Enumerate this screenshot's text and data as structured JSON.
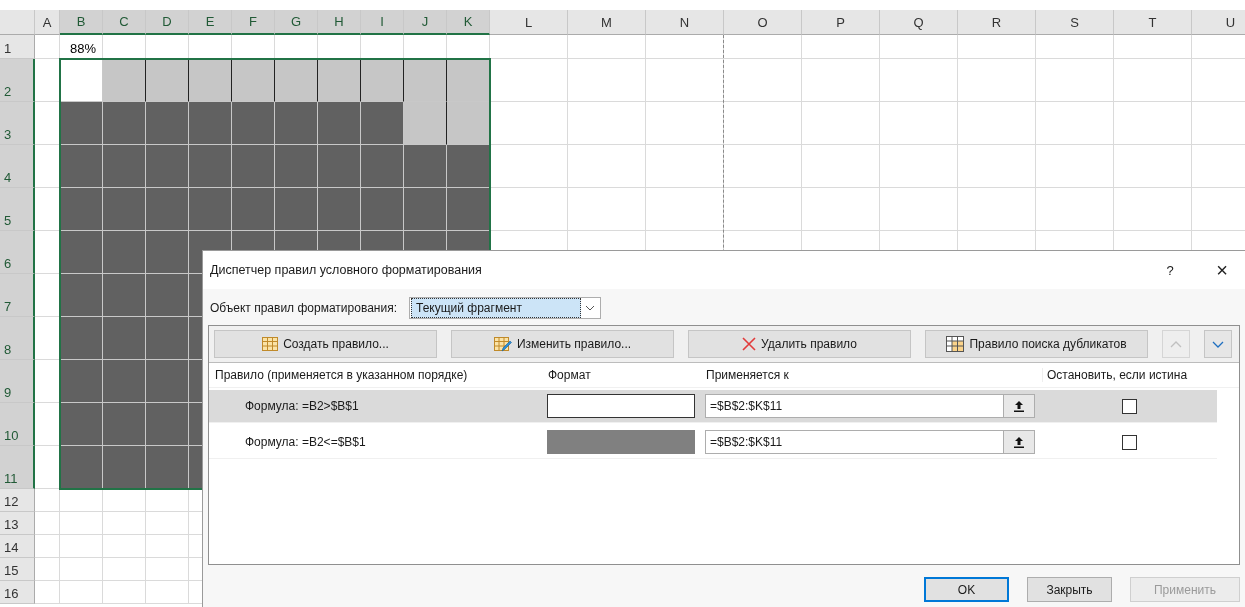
{
  "sheet": {
    "columns": [
      {
        "label": "A",
        "selected": false,
        "page_break": false
      },
      {
        "label": "B",
        "selected": true,
        "page_break": false
      },
      {
        "label": "C",
        "selected": true,
        "page_break": false
      },
      {
        "label": "D",
        "selected": true,
        "page_break": false
      },
      {
        "label": "E",
        "selected": true,
        "page_break": false
      },
      {
        "label": "F",
        "selected": true,
        "page_break": false
      },
      {
        "label": "G",
        "selected": true,
        "page_break": false
      },
      {
        "label": "H",
        "selected": true,
        "page_break": false
      },
      {
        "label": "I",
        "selected": true,
        "page_break": false
      },
      {
        "label": "J",
        "selected": true,
        "page_break": false
      },
      {
        "label": "K",
        "selected": true,
        "page_break": false
      },
      {
        "label": "L",
        "selected": false,
        "page_break": false
      },
      {
        "label": "M",
        "selected": false,
        "page_break": false
      },
      {
        "label": "N",
        "selected": false,
        "page_break": true
      },
      {
        "label": "O",
        "selected": false,
        "page_break": false
      },
      {
        "label": "P",
        "selected": false,
        "page_break": false
      },
      {
        "label": "Q",
        "selected": false,
        "page_break": false
      },
      {
        "label": "R",
        "selected": false,
        "page_break": false
      },
      {
        "label": "S",
        "selected": false,
        "page_break": false
      },
      {
        "label": "T",
        "selected": false,
        "page_break": false
      },
      {
        "label": "U",
        "selected": false,
        "page_break": false
      }
    ],
    "rows": [
      {
        "label": "1",
        "selected": false,
        "value_b": "88%"
      },
      {
        "label": "2",
        "selected": true,
        "cells": [
          {
            "color": "#ffffff"
          },
          {
            "color": "#c6c6c6"
          },
          {
            "color": "#c6c6c6"
          },
          {
            "color": "#c6c6c6"
          },
          {
            "color": "#c6c6c6"
          },
          {
            "color": "#c6c6c6"
          },
          {
            "color": "#c6c6c6"
          },
          {
            "color": "#c6c6c6"
          },
          {
            "color": "#c6c6c6"
          },
          {
            "color": "#c6c6c6"
          }
        ]
      },
      {
        "label": "3",
        "selected": true,
        "cells": [
          {
            "color": "#616161"
          },
          {
            "color": "#616161"
          },
          {
            "color": "#616161"
          },
          {
            "color": "#616161"
          },
          {
            "color": "#616161"
          },
          {
            "color": "#616161"
          },
          {
            "color": "#616161"
          },
          {
            "color": "#616161"
          },
          {
            "color": "#c6c6c6"
          },
          {
            "color": "#c6c6c6"
          }
        ]
      },
      {
        "label": "4",
        "selected": true,
        "cells": [
          {
            "color": "#616161"
          },
          {
            "color": "#616161"
          },
          {
            "color": "#616161"
          },
          {
            "color": "#616161"
          },
          {
            "color": "#616161"
          },
          {
            "color": "#616161"
          },
          {
            "color": "#616161"
          },
          {
            "color": "#616161"
          },
          {
            "color": "#616161"
          },
          {
            "color": "#616161"
          }
        ]
      },
      {
        "label": "5",
        "selected": true,
        "cells": [
          {
            "color": "#616161"
          },
          {
            "color": "#616161"
          },
          {
            "color": "#616161"
          },
          {
            "color": "#616161"
          },
          {
            "color": "#616161"
          },
          {
            "color": "#616161"
          },
          {
            "color": "#616161"
          },
          {
            "color": "#616161"
          },
          {
            "color": "#616161"
          },
          {
            "color": "#616161"
          }
        ]
      },
      {
        "label": "6",
        "selected": true,
        "cells": [
          {
            "color": "#616161"
          },
          {
            "color": "#616161"
          },
          {
            "color": "#616161"
          },
          {
            "color": "#616161"
          },
          {
            "color": "#616161"
          },
          {
            "color": "#616161"
          },
          {
            "color": "#616161"
          },
          {
            "color": "#616161"
          },
          {
            "color": "#616161"
          },
          {
            "color": "#616161"
          }
        ]
      },
      {
        "label": "7",
        "selected": true,
        "cells": [
          {
            "color": "#616161"
          },
          {
            "color": "#616161"
          },
          {
            "color": "#616161"
          },
          {
            "color": "#616161"
          }
        ]
      },
      {
        "label": "8",
        "selected": true,
        "cells": [
          {
            "color": "#616161"
          },
          {
            "color": "#616161"
          },
          {
            "color": "#616161"
          },
          {
            "color": "#616161"
          }
        ]
      },
      {
        "label": "9",
        "selected": true,
        "cells": [
          {
            "color": "#616161"
          },
          {
            "color": "#616161"
          },
          {
            "color": "#616161"
          },
          {
            "color": "#616161"
          }
        ]
      },
      {
        "label": "10",
        "selected": true,
        "cells": [
          {
            "color": "#616161"
          },
          {
            "color": "#616161"
          },
          {
            "color": "#616161"
          },
          {
            "color": "#616161"
          }
        ]
      },
      {
        "label": "11",
        "selected": true,
        "cells": [
          {
            "color": "#616161"
          },
          {
            "color": "#616161"
          },
          {
            "color": "#616161"
          },
          {
            "color": "#616161"
          }
        ]
      },
      {
        "label": "12",
        "selected": false
      },
      {
        "label": "13",
        "selected": false
      },
      {
        "label": "14",
        "selected": false
      },
      {
        "label": "15",
        "selected": false
      },
      {
        "label": "16",
        "selected": false
      }
    ]
  },
  "dialog": {
    "title": "Диспетчер правил условного форматирования",
    "help": "?",
    "close": "×",
    "scope_label": "Объект правил форматирования:",
    "scope_value": "Текущий фрагмент",
    "toolbar": [
      {
        "label": "Создать правило...",
        "kind": "new"
      },
      {
        "label": "Изменить правило...",
        "kind": "edit"
      },
      {
        "label": "Удалить правило",
        "kind": "delete"
      },
      {
        "label": "Правило поиска дубликатов",
        "kind": "duplicate"
      }
    ],
    "move_up": {
      "disabled": true
    },
    "move_down": {
      "disabled": false
    },
    "columns": [
      "Правило (применяется в указанном порядке)",
      "Формат",
      "Применяется к",
      "Остановить, если истина"
    ],
    "rules": [
      {
        "formula": "Формула: =B2>$B$1",
        "format": {
          "color": "#ffffff"
        },
        "applies_to": "=$B$2:$K$11",
        "stop_if_true": false,
        "selected": true
      },
      {
        "formula": "Формула: =B2<=$B$1",
        "format": {
          "color": "#808080"
        },
        "applies_to": "=$B$2:$K$11",
        "stop_if_true": false,
        "selected": false
      }
    ],
    "buttons": [
      {
        "label": "OK",
        "default": true,
        "disabled": false
      },
      {
        "label": "Закрыть",
        "default": false,
        "disabled": false
      },
      {
        "label": "Применить",
        "default": false,
        "disabled": true
      }
    ]
  }
}
